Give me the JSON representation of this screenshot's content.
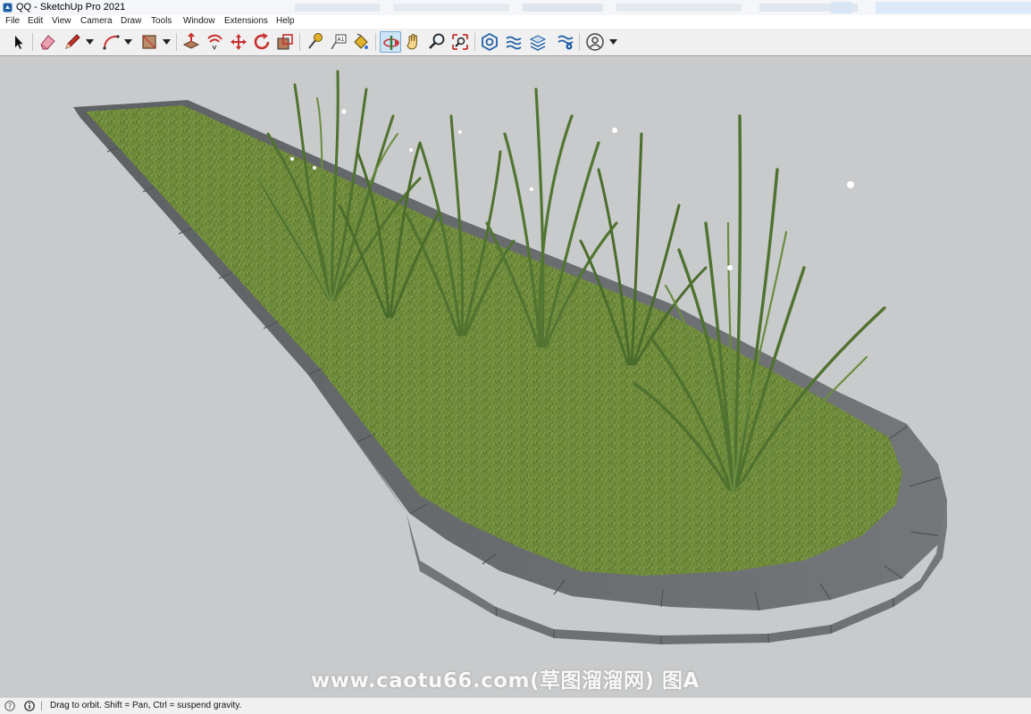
{
  "window": {
    "title": "QQ - SketchUp Pro 2021"
  },
  "menu": {
    "items": [
      {
        "label": "File"
      },
      {
        "label": "Edit"
      },
      {
        "label": "View"
      },
      {
        "label": "Camera"
      },
      {
        "label": "Draw"
      },
      {
        "label": "Tools"
      },
      {
        "label": "Window"
      },
      {
        "label": "Extensions"
      },
      {
        "label": "Help"
      }
    ]
  },
  "toolbar": {
    "tools": [
      {
        "name": "select",
        "icon": "arrow-cursor-icon"
      },
      {
        "name": "eraser",
        "icon": "eraser-icon"
      },
      {
        "name": "line",
        "icon": "pencil-icon",
        "dropdown": true
      },
      {
        "name": "arc",
        "icon": "arc-icon",
        "dropdown": true
      },
      {
        "name": "rectangle",
        "icon": "rectangle-icon",
        "dropdown": true
      },
      {
        "name": "push-pull",
        "icon": "push-pull-icon"
      },
      {
        "name": "offset",
        "icon": "offset-icon"
      },
      {
        "name": "move",
        "icon": "move-icon"
      },
      {
        "name": "rotate",
        "icon": "rotate-icon"
      },
      {
        "name": "scale",
        "icon": "scale-icon"
      },
      {
        "name": "tape-measure",
        "icon": "tape-measure-icon"
      },
      {
        "name": "text",
        "icon": "text-icon"
      },
      {
        "name": "paint-bucket",
        "icon": "paint-bucket-icon"
      },
      {
        "name": "orbit",
        "icon": "orbit-icon",
        "active": true
      },
      {
        "name": "pan",
        "icon": "pan-hand-icon"
      },
      {
        "name": "zoom",
        "icon": "zoom-icon"
      },
      {
        "name": "zoom-extents",
        "icon": "zoom-extents-icon"
      },
      {
        "name": "3d-warehouse",
        "icon": "warehouse-icon"
      },
      {
        "name": "extension-warehouse",
        "icon": "extension-warehouse-icon"
      },
      {
        "name": "layout",
        "icon": "layout-icon"
      },
      {
        "name": "extension-manager",
        "icon": "extension-manager-icon"
      },
      {
        "name": "account",
        "icon": "user-account-icon",
        "dropdown": true
      }
    ]
  },
  "watermark": {
    "text": "www.caotu66.com(草图溜溜网) 图A"
  },
  "status": {
    "text": "Drag to orbit. Shift = Pan, Ctrl = suspend gravity."
  },
  "colors": {
    "viewport_bg": "#c9cacb",
    "grass": "#6d8a3a",
    "curb": "#6f7274",
    "plant": "#4a6a2e",
    "orbit_active_bg": "#cde4f7"
  }
}
